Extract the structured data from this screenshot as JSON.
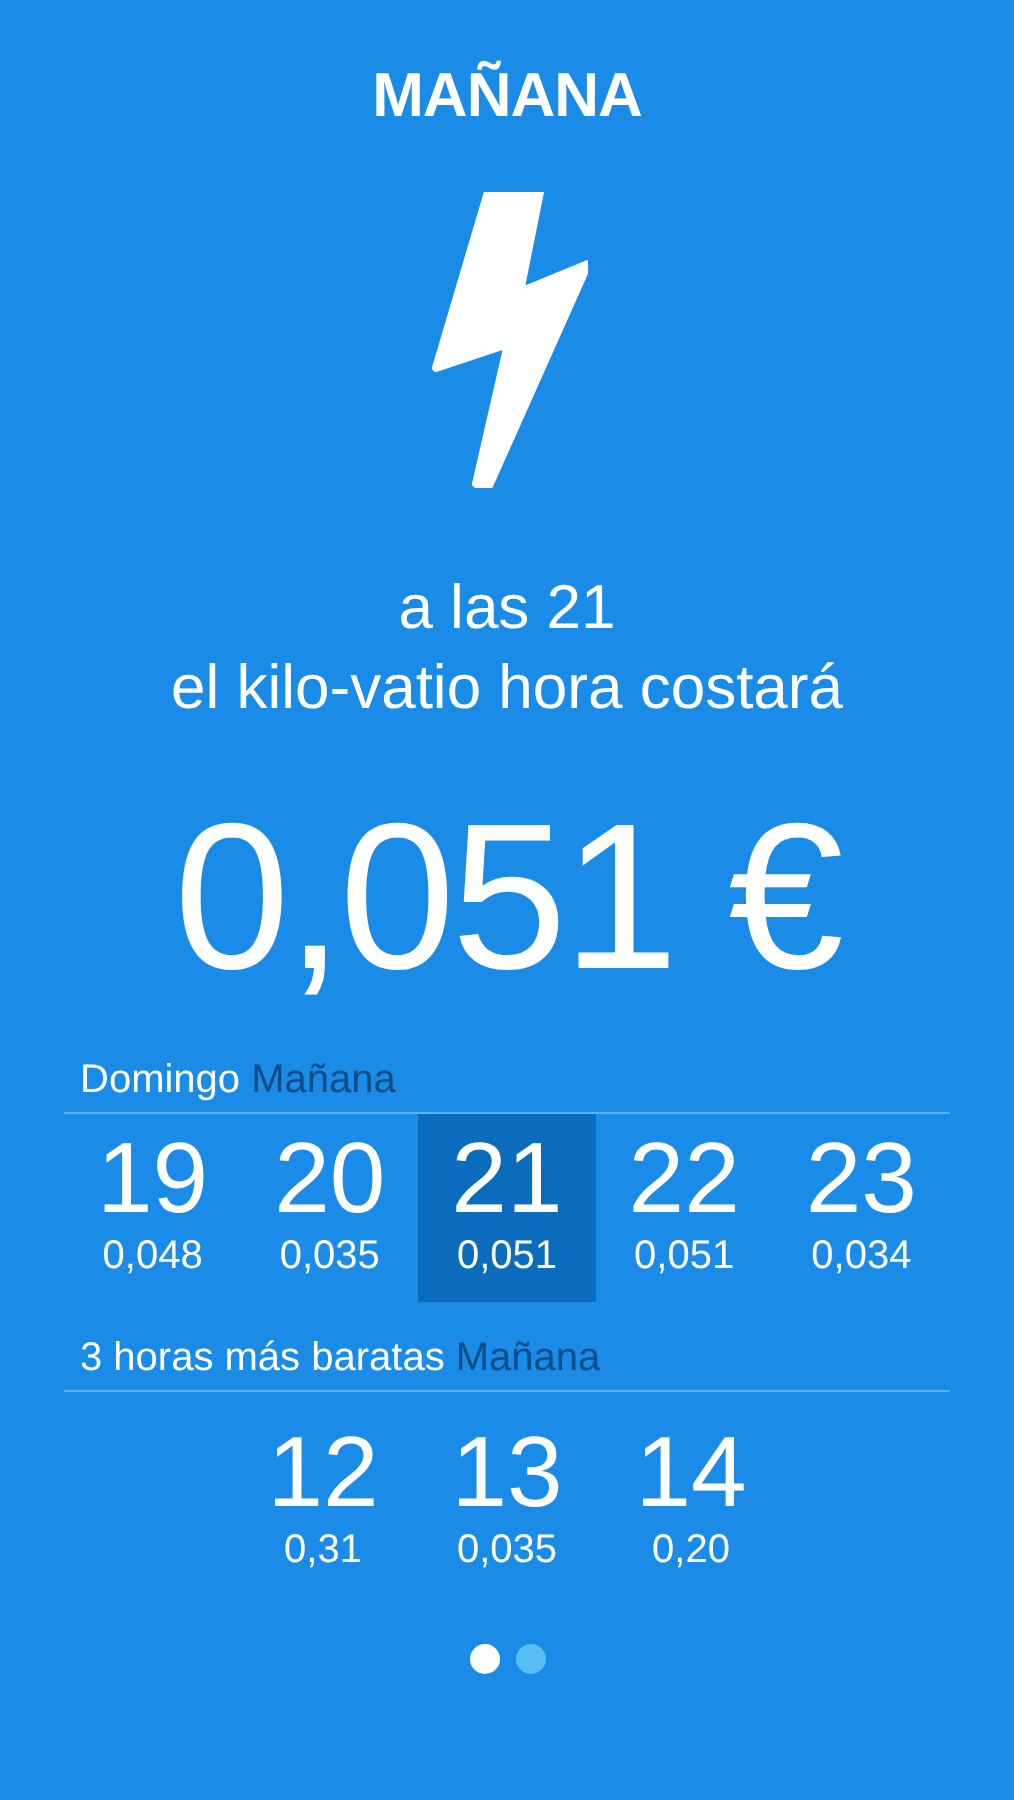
{
  "title": "MAÑANA",
  "headline": [
    "a las 21",
    "el kilo-vatio hora costará"
  ],
  "price": "0,051 €",
  "hours_section": {
    "label": "Domingo",
    "tag": "Mañana",
    "hours": [
      {
        "hour": "19",
        "price": "0,048",
        "selected": false
      },
      {
        "hour": "20",
        "price": "0,035",
        "selected": false
      },
      {
        "hour": "21",
        "price": "0,051",
        "selected": true
      },
      {
        "hour": "22",
        "price": "0,051",
        "selected": false
      },
      {
        "hour": "23",
        "price": "0,034",
        "selected": false
      }
    ]
  },
  "cheapest_section": {
    "label": "3 horas más baratas",
    "tag": "Mañana",
    "hours": [
      {
        "hour": "12",
        "price": "0,31"
      },
      {
        "hour": "13",
        "price": "0,035"
      },
      {
        "hour": "14",
        "price": "0,20"
      }
    ]
  },
  "pages": [
    {
      "selected": true
    },
    {
      "selected": false
    }
  ]
}
